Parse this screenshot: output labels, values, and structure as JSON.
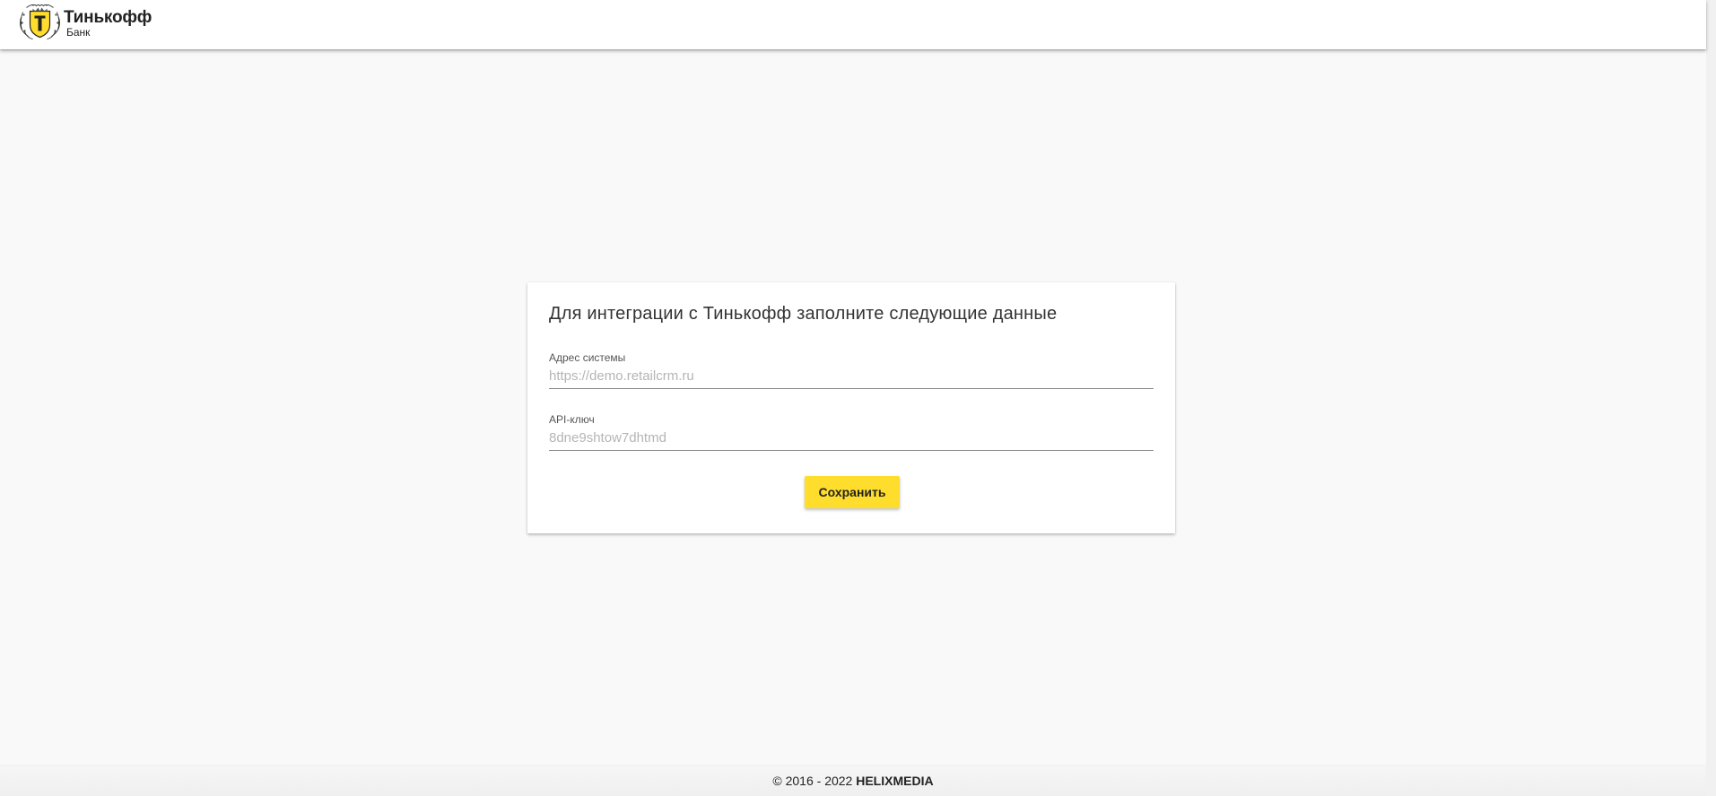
{
  "header": {
    "logo": {
      "icon": "tinkoff-emblem-icon",
      "name": "Тинькофф",
      "sub": "Банк"
    }
  },
  "form": {
    "title": "Для интеграции с Тинькофф заполните следующие данные",
    "fields": [
      {
        "label": "Адрес системы",
        "value": "",
        "placeholder": "https://demo.retailcrm.ru"
      },
      {
        "label": "API-ключ",
        "value": "",
        "placeholder": "8dne9shtow7dhtmd"
      }
    ],
    "submit_label": "Сохранить"
  },
  "footer": {
    "copyright": "© 2016 - 2022 ",
    "brand": "HELIXMEDIA"
  },
  "colors": {
    "accent": "#ffdd2d",
    "page_background": "#f9f9f9",
    "card_background": "#ffffff",
    "text": "#333333"
  }
}
